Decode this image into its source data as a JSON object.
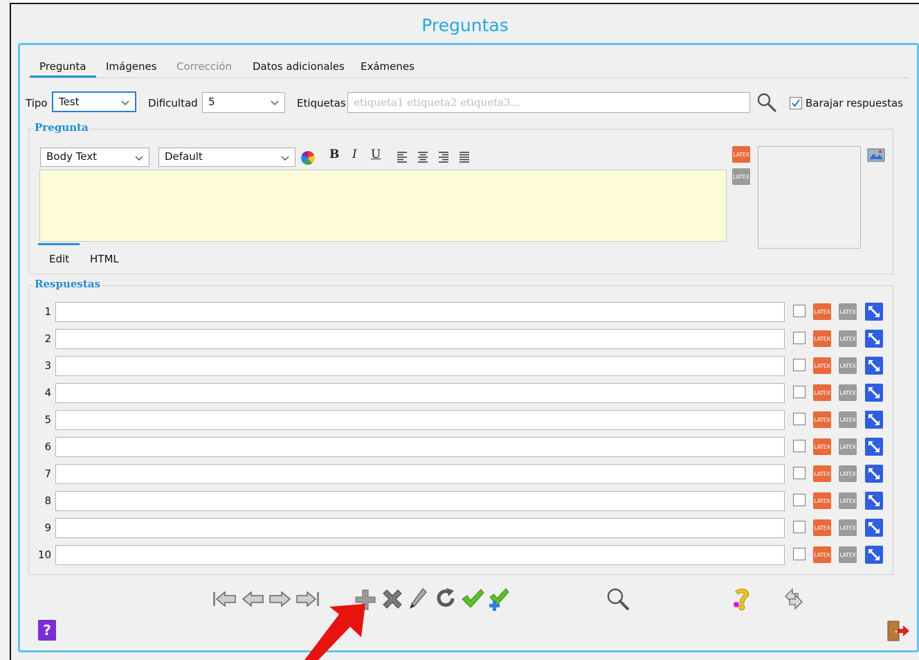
{
  "window": {
    "title": "Preguntas"
  },
  "tabs": [
    {
      "label": "Pregunta",
      "active": true,
      "enabled": true
    },
    {
      "label": "Imágenes",
      "active": false,
      "enabled": true
    },
    {
      "label": "Corrección",
      "active": false,
      "enabled": false
    },
    {
      "label": "Datos adicionales",
      "active": false,
      "enabled": true
    },
    {
      "label": "Exámenes",
      "active": false,
      "enabled": true
    }
  ],
  "filters": {
    "tipo_label": "Tipo",
    "tipo_value": "Test",
    "dificultad_label": "Dificultad",
    "dificultad_value": "5",
    "etiquetas_label": "Etiquetas",
    "etiquetas_placeholder": "etiqueta1 etiqueta2 etiqueta3...",
    "shuffle_label": "Barajar respuestas",
    "shuffle_checked": true
  },
  "question": {
    "group_title": "Pregunta",
    "style_value": "Body Text",
    "font_value": "Default",
    "format_buttons": [
      "B",
      "I",
      "U"
    ],
    "latex_label": "LATEX",
    "editor_tabs": [
      "Edit",
      "HTML"
    ]
  },
  "answers": {
    "group_title": "Respuestas",
    "rows": [
      {
        "num": "1",
        "value": "",
        "correct": false
      },
      {
        "num": "2",
        "value": "",
        "correct": false
      },
      {
        "num": "3",
        "value": "",
        "correct": false
      },
      {
        "num": "4",
        "value": "",
        "correct": false
      },
      {
        "num": "5",
        "value": "",
        "correct": false
      },
      {
        "num": "6",
        "value": "",
        "correct": false
      },
      {
        "num": "7",
        "value": "",
        "correct": false
      },
      {
        "num": "8",
        "value": "",
        "correct": false
      },
      {
        "num": "9",
        "value": "",
        "correct": false
      },
      {
        "num": "10",
        "value": "",
        "correct": false
      }
    ]
  },
  "help_button_label": "?",
  "colors": {
    "accent": "#29a6de",
    "panel_border": "#5cc4ea",
    "editor_bg": "#fefcd6",
    "latex_orange": "#e96a3a",
    "arrow": "#e8130f"
  }
}
